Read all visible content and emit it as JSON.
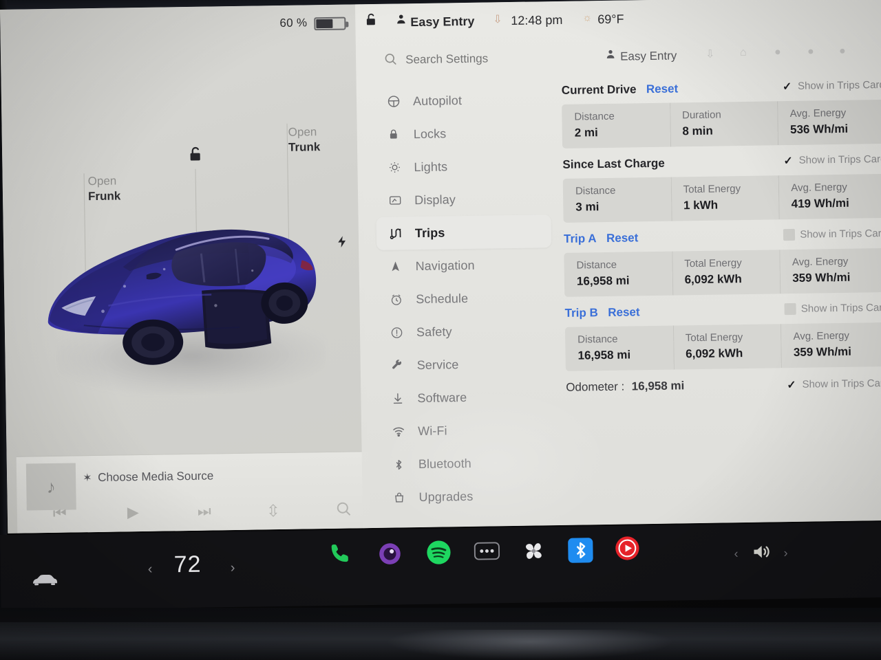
{
  "status_bar": {
    "battery_percent": "60 %",
    "lock_state_icon": "unlocked-padlock-icon",
    "profile_icon": "person-icon",
    "profile_name": "Easy Entry",
    "download_icon": "download-icon",
    "time": "12:48 pm",
    "weather_icon": "sun-icon",
    "temperature": "69°F"
  },
  "car_panel": {
    "open_frunk": {
      "line1": "Open",
      "line2": "Frunk"
    },
    "open_trunk": {
      "line1": "Open",
      "line2": "Trunk"
    },
    "lock_icon": "unlocked-padlock-icon",
    "charge_port_icon": "lightning-bolt-icon",
    "vehicle_color": "#2a2a7d"
  },
  "media_bar": {
    "album_art_icon": "music-note-icon",
    "bluetooth_icon": "bluetooth-icon",
    "source_label": "Choose Media Source",
    "controls": [
      {
        "name": "previous-track-button",
        "glyph": "⏮"
      },
      {
        "name": "play-button",
        "glyph": "▶"
      },
      {
        "name": "next-track-button",
        "glyph": "⏭"
      },
      {
        "name": "equalizer-button",
        "glyph": "⇵"
      },
      {
        "name": "search-media-button",
        "glyph": "search-icon"
      }
    ]
  },
  "settings": {
    "search": {
      "icon": "search-icon",
      "placeholder": "Search Settings"
    },
    "profile": {
      "icon": "person-icon",
      "name": "Easy Entry"
    },
    "nav_items": [
      {
        "label": "Autopilot",
        "icon": "steering-wheel-icon",
        "active": false
      },
      {
        "label": "Locks",
        "icon": "lock-icon",
        "active": false
      },
      {
        "label": "Lights",
        "icon": "lightbulb-icon",
        "active": false
      },
      {
        "label": "Display",
        "icon": "display-icon",
        "active": false
      },
      {
        "label": "Trips",
        "icon": "trips-route-icon",
        "active": true
      },
      {
        "label": "Navigation",
        "icon": "navigation-arrow-icon",
        "active": false
      },
      {
        "label": "Schedule",
        "icon": "clock-icon",
        "active": false
      },
      {
        "label": "Safety",
        "icon": "warning-circle-icon",
        "active": false
      },
      {
        "label": "Service",
        "icon": "wrench-icon",
        "active": false
      },
      {
        "label": "Software",
        "icon": "download-icon",
        "active": false
      },
      {
        "label": "Wi-Fi",
        "icon": "wifi-icon",
        "active": false
      },
      {
        "label": "Bluetooth",
        "icon": "bluetooth-icon",
        "active": false
      },
      {
        "label": "Upgrades",
        "icon": "bag-icon",
        "active": false
      }
    ]
  },
  "trips": {
    "show_in_trips_card_label": "Show in Trips Card",
    "reset_label": "Reset",
    "sections": [
      {
        "title": "Current Drive",
        "has_reset": true,
        "title_is_link": false,
        "show_in_trips_card": true,
        "cells": [
          {
            "label": "Distance",
            "value": "2 mi"
          },
          {
            "label": "Duration",
            "value": "8 min"
          },
          {
            "label": "Avg. Energy",
            "value": "536 Wh/mi"
          }
        ]
      },
      {
        "title": "Since Last Charge",
        "has_reset": false,
        "title_is_link": false,
        "show_in_trips_card": true,
        "cells": [
          {
            "label": "Distance",
            "value": "3 mi"
          },
          {
            "label": "Total Energy",
            "value": "1 kWh"
          },
          {
            "label": "Avg. Energy",
            "value": "419 Wh/mi"
          }
        ]
      },
      {
        "title": "Trip A",
        "has_reset": true,
        "title_is_link": true,
        "show_in_trips_card": false,
        "cells": [
          {
            "label": "Distance",
            "value": "16,958 mi"
          },
          {
            "label": "Total Energy",
            "value": "6,092 kWh"
          },
          {
            "label": "Avg. Energy",
            "value": "359 Wh/mi"
          }
        ]
      },
      {
        "title": "Trip B",
        "has_reset": true,
        "title_is_link": true,
        "show_in_trips_card": false,
        "cells": [
          {
            "label": "Distance",
            "value": "16,958 mi"
          },
          {
            "label": "Total Energy",
            "value": "6,092 kWh"
          },
          {
            "label": "Avg. Energy",
            "value": "359 Wh/mi"
          }
        ]
      }
    ],
    "odometer": {
      "label": "Odometer :",
      "value": "16,958 mi",
      "show_in_trips_card": true
    }
  },
  "taskbar": {
    "car_icon": "car-icon",
    "temp_down_icon": "chevron-left-icon",
    "temperature": "72",
    "temp_up_icon": "chevron-right-icon",
    "apps": [
      {
        "name": "phone-app-icon",
        "color": "#22c95a"
      },
      {
        "name": "camera-app-icon",
        "color": "#7b3fb5"
      },
      {
        "name": "spotify-app-icon",
        "color": "#1ed760"
      },
      {
        "name": "more-apps-icon",
        "color": "#9a9aa0"
      },
      {
        "name": "climate-fan-icon",
        "color": "#e8e8ea"
      },
      {
        "name": "bluetooth-app-icon",
        "color": "#1f8cf0"
      },
      {
        "name": "youtube-music-icon",
        "color": "#e8232a"
      }
    ],
    "volume_icon": "speaker-volume-icon",
    "volume_down_icon": "chevron-left-icon",
    "volume_up_icon": "chevron-right-icon"
  }
}
